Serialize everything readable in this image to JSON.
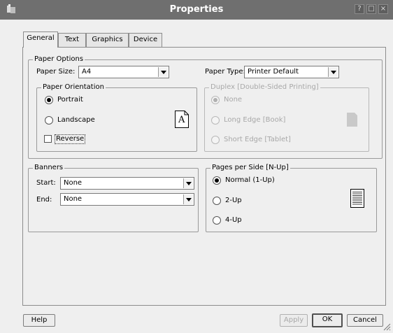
{
  "window": {
    "title": "Properties",
    "help_btn": "?",
    "max_btn": "□",
    "close_btn": "×"
  },
  "tabs": [
    "General",
    "Text",
    "Graphics",
    "Device"
  ],
  "paper_options": {
    "legend": "Paper Options",
    "size_label": "Paper Size:",
    "size_value": "A4",
    "type_label": "Paper Type:",
    "type_value": "Printer Default"
  },
  "orientation": {
    "legend": "Paper Orientation",
    "portrait": "Portrait",
    "landscape": "Landscape",
    "reverse": "Reverse",
    "preview_glyph": "A"
  },
  "duplex": {
    "legend": "Duplex [Double-Sided Printing]",
    "none": "None",
    "long": "Long Edge [Book]",
    "short": "Short Edge [Tablet]"
  },
  "banners": {
    "legend": "Banners",
    "start_label": "Start:",
    "start_value": "None",
    "end_label": "End:",
    "end_value": "None"
  },
  "nup": {
    "legend": "Pages per Side [N-Up]",
    "n1": "Normal (1-Up)",
    "n2": "2-Up",
    "n4": "4-Up"
  },
  "footer": {
    "help": "Help",
    "apply": "Apply",
    "ok": "OK",
    "cancel": "Cancel"
  }
}
